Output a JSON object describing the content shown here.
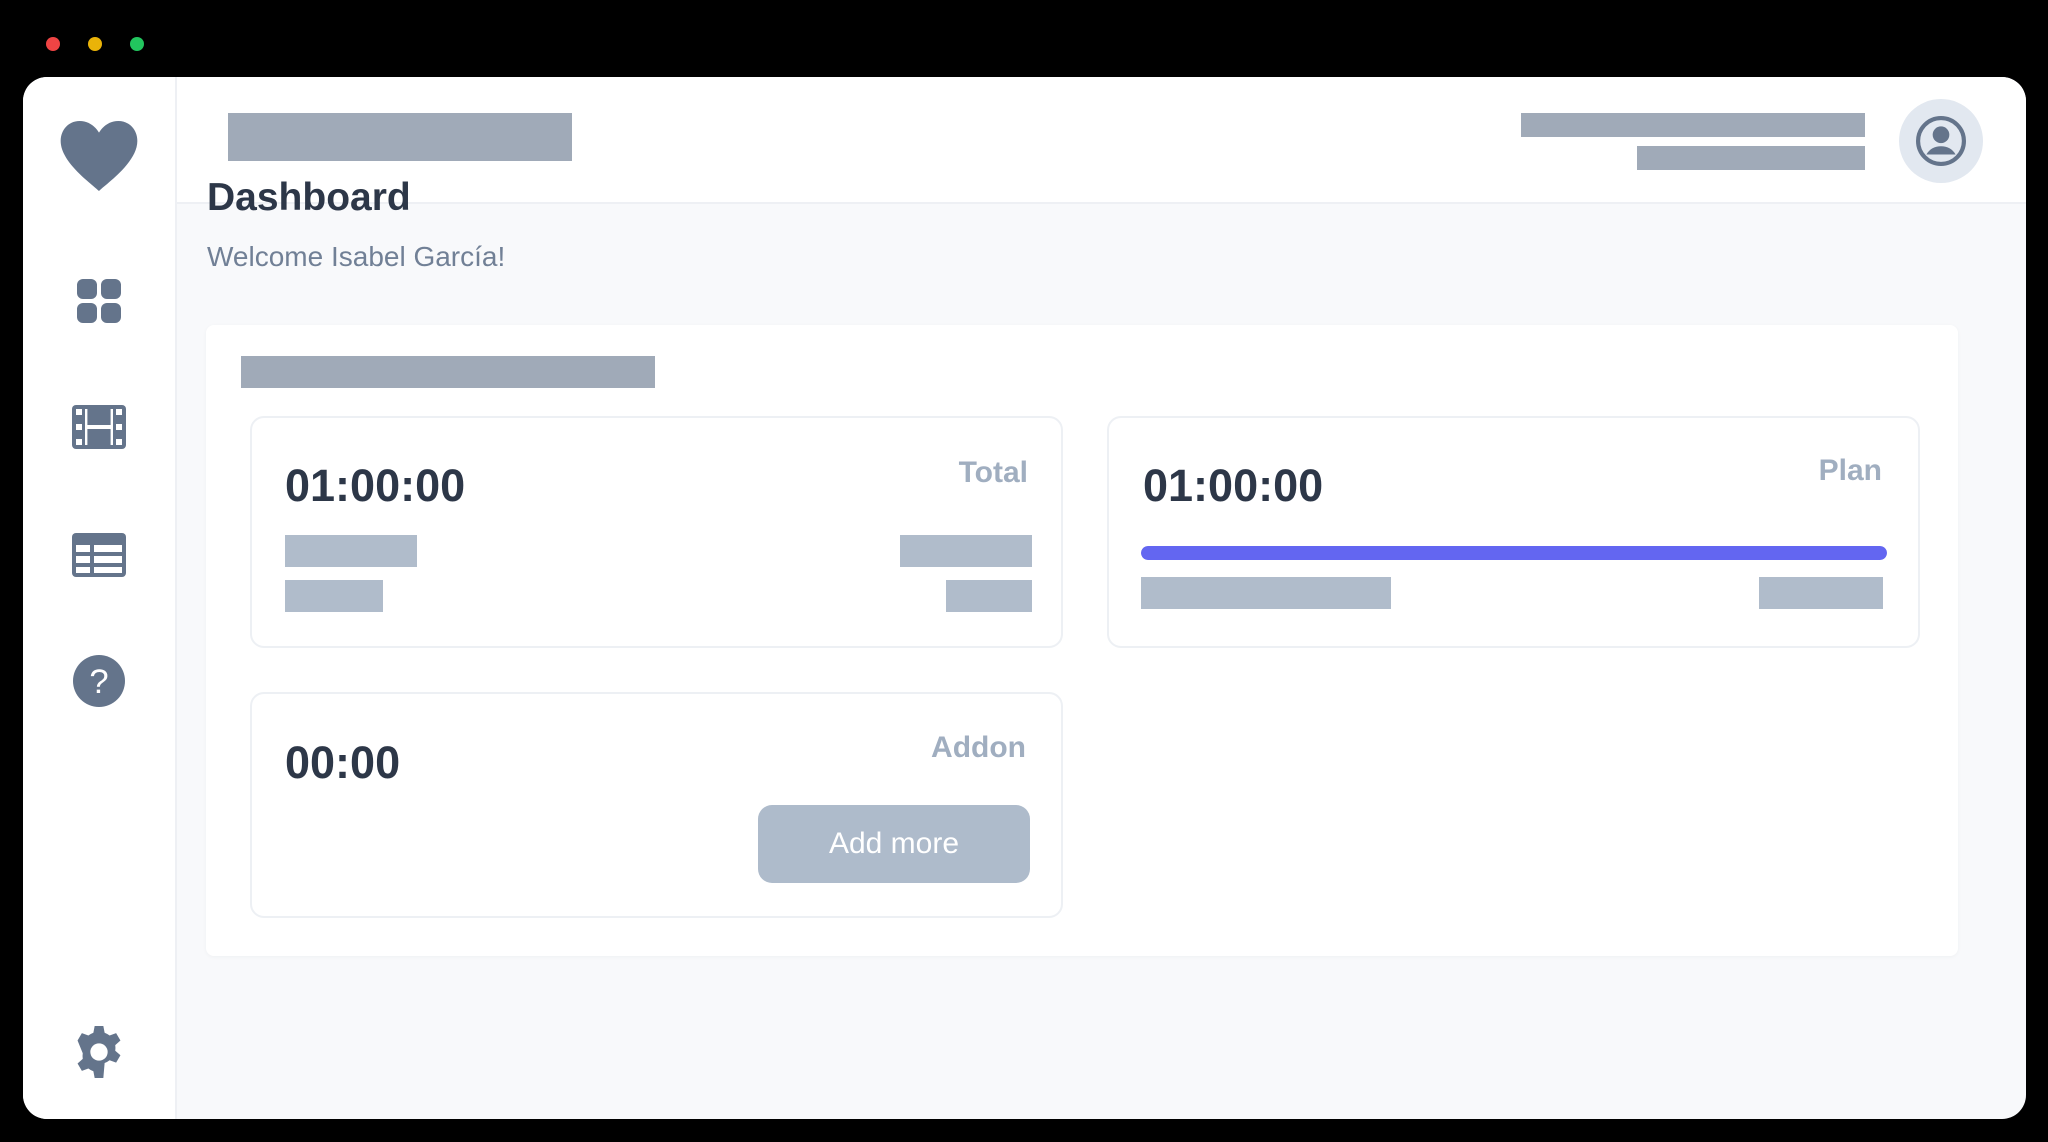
{
  "window": {
    "controls": [
      "close",
      "minimize",
      "maximize"
    ]
  },
  "sidebar": {
    "items": [
      {
        "icon": "heart-logo-icon"
      },
      {
        "icon": "grid-icon"
      },
      {
        "icon": "film-icon"
      },
      {
        "icon": "table-icon"
      },
      {
        "icon": "help-icon"
      },
      {
        "icon": "gear-icon"
      }
    ]
  },
  "header": {
    "avatar_icon": "user-circle-icon"
  },
  "main": {
    "title": "Dashboard",
    "welcome": "Welcome Isabel García!"
  },
  "cards": {
    "total": {
      "time": "01:00:00",
      "label": "Total"
    },
    "plan": {
      "time": "01:00:00",
      "label": "Plan",
      "progress": 1.0
    },
    "addon": {
      "time": "00:00",
      "label": "Addon",
      "button_label": "Add more"
    }
  },
  "colors": {
    "accent": "#6366f1",
    "icon": "#64748b",
    "placeholder": "#a0aab8"
  }
}
